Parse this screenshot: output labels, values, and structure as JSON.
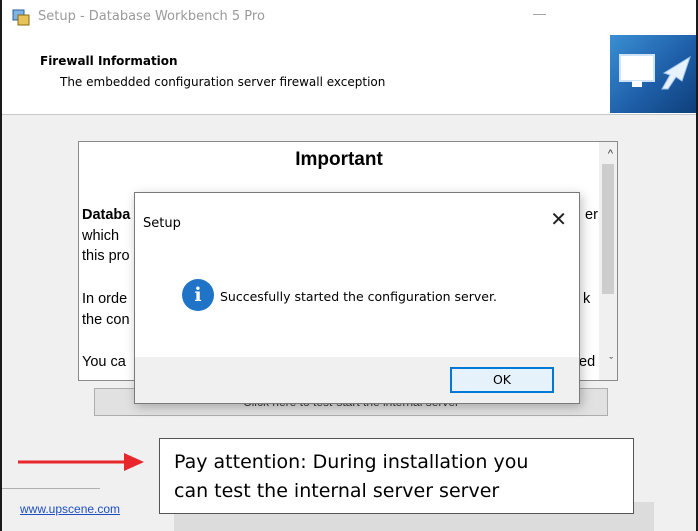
{
  "window": {
    "title": "Setup - Database Workbench 5 Pro",
    "minimize_glyph": "—"
  },
  "header": {
    "title": "Firewall Information",
    "subtitle": "The embedded configuration server firewall exception"
  },
  "memo": {
    "heading": "Important",
    "lines": [
      "Databa",
      "which",
      "this pro",
      "In orde",
      "the con",
      "You ca"
    ],
    "right_fragments": [
      "er",
      "k",
      "ed"
    ]
  },
  "test_button": {
    "label": "Click here to test-start the internal server"
  },
  "footer": {
    "link": "www.upscene.com"
  },
  "dialog": {
    "title": "Setup",
    "message": "Succesfully started the configuration server.",
    "ok_label": "OK",
    "icon": "info-icon",
    "close_icon": "close-icon"
  },
  "annotation": {
    "line1": "Pay attention: During installation you",
    "line2": "can test the internal server server",
    "arrow_color": "#e8262b"
  }
}
